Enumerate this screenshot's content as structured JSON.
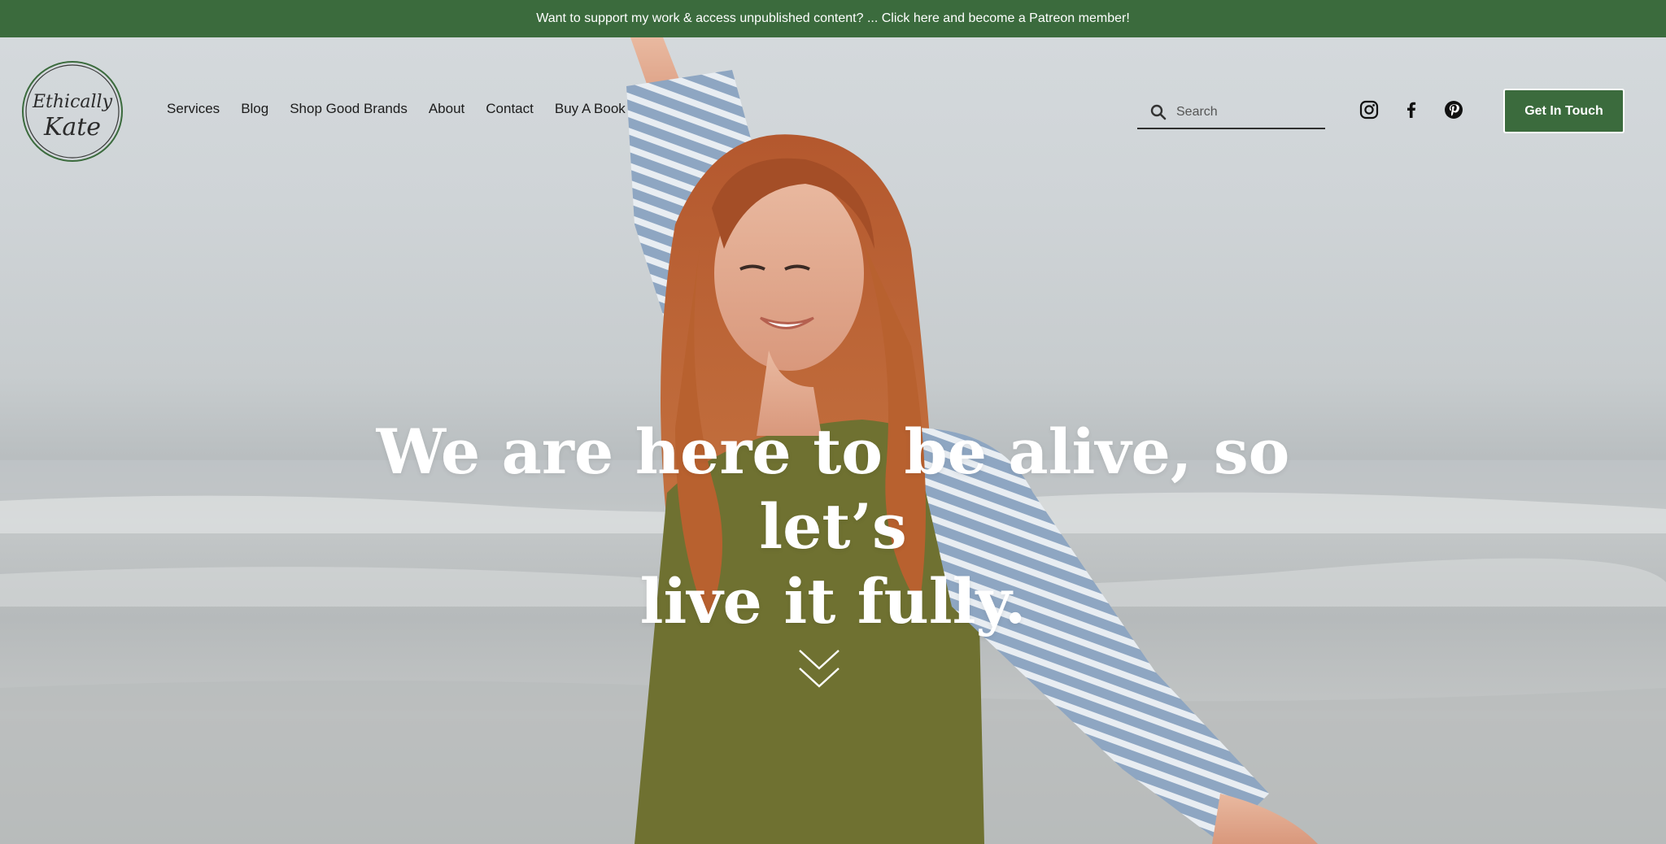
{
  "announcement": {
    "text": "Want to support my work & access unpublished content?  ... Click here and become a Patreon member!"
  },
  "logo": {
    "line1": "Ethically",
    "line2": "Kate",
    "icon": "ethically-kate-logo"
  },
  "nav": {
    "items": [
      {
        "label": "Services"
      },
      {
        "label": "Blog"
      },
      {
        "label": "Shop Good Brands"
      },
      {
        "label": "About"
      },
      {
        "label": "Contact"
      },
      {
        "label": "Buy A Book"
      }
    ]
  },
  "search": {
    "placeholder": "Search",
    "icon": "search-icon"
  },
  "social": {
    "icons": [
      "instagram-icon",
      "facebook-icon",
      "pinterest-icon"
    ]
  },
  "cta": {
    "label": "Get In Touch"
  },
  "hero": {
    "headline_line1": "We are here to be alive, so let’s",
    "headline_line2": "live it fully.",
    "scroll_icon": "chevron-double-down-icon"
  },
  "colors": {
    "brand_green": "#3b6b3d",
    "text_dark": "#1c1c1c",
    "white": "#ffffff"
  }
}
